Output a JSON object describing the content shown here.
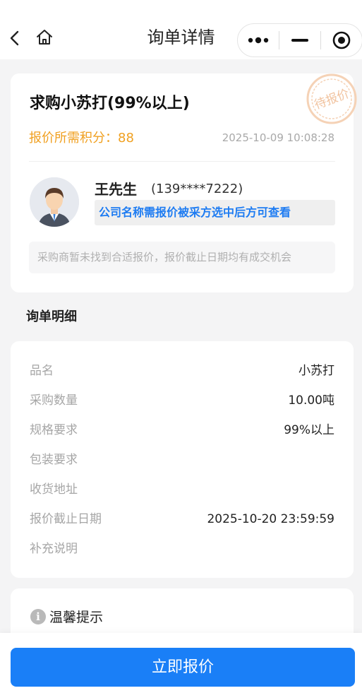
{
  "nav": {
    "title": "询单详情",
    "back_icon": "chevron-left-icon",
    "home_icon": "home-icon",
    "capsule": {
      "more_icon": "more-dots-icon",
      "minimize_icon": "minimize-icon",
      "close_icon": "target-close-icon"
    }
  },
  "inquiry": {
    "product_title": "求购小苏打(99%以上)",
    "points_label": "报价所需积分：88",
    "date": "2025-10-09 10:08:28",
    "stamp_text": "待报价",
    "buyer_name": "王先生",
    "buyer_phone": "(139****7222)",
    "company_note": "公司名称需报价被采方选中后方可查看",
    "tip": "采购商暂未找到合适报价，报价截止日期均有成交机会"
  },
  "detail": {
    "section_title": "询单明细",
    "rows": [
      {
        "label": "品名",
        "value": "小苏打"
      },
      {
        "label": "采购数量",
        "value": "10.00吨"
      },
      {
        "label": "规格要求",
        "value": "99%以上"
      },
      {
        "label": "包装要求",
        "value": ""
      },
      {
        "label": "收货地址",
        "value": ""
      },
      {
        "label": "报价截止日期",
        "value": "2025-10-20 23:59:59"
      },
      {
        "label": "补充说明",
        "value": ""
      }
    ]
  },
  "warm": {
    "icon": "info-icon",
    "icon_glyph": "i",
    "title": "温馨提示"
  },
  "footer": {
    "quote_button": "立即报价"
  },
  "colors": {
    "accent": "#1a7ff7",
    "points": "#f0a020",
    "company_note": "#1e7cf2",
    "stamp": "#f3c9a8"
  }
}
